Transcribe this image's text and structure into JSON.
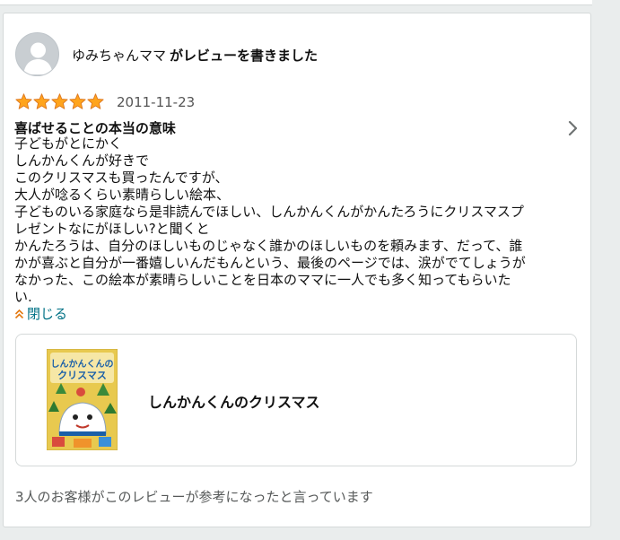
{
  "review": {
    "author_name": "ゆみちゃんママ",
    "author_action": "がレビューを書きました",
    "rating": 5,
    "rating_max": 5,
    "date": "2011-11-23",
    "title": "喜ばせることの本当の意味",
    "body_lines": [
      "子どもがとにかく",
      "しんかんくんが好きで",
      "このクリスマスも買ったんですが、",
      "大人が唸るくらい素晴らしい絵本、",
      "子どものいる家庭なら是非読んでほしい、しんかんくんがかんたろうにクリスマスプ",
      "レゼントなにがほしい?と聞くと",
      "かんたろうは、自分のほしいものじゃなく誰かのほしいものを頼みます、だって、誰",
      "かが喜ぶと自分が一番嬉しいんだもんという、最後のページでは、涙がでてしょうが",
      "なかった、この絵本が素晴らしいことを日本のママに一人でも多く知ってもらいた",
      "い."
    ],
    "collapse_label": "閉じる",
    "helpful_text": "3人のお客様がこのレビューが参考になったと言っています"
  },
  "product": {
    "title": "しんかんくんのクリスマス",
    "cover_title": "しんかんくんのクリスマス"
  },
  "colors": {
    "star": "#ffa41c",
    "link": "#007185",
    "caret": "#e47911",
    "border": "#d5d9d9"
  },
  "icons": {
    "avatar": "default-user-avatar",
    "chevron": "chevron-right-icon",
    "collapse": "double-chevron-up-icon"
  }
}
